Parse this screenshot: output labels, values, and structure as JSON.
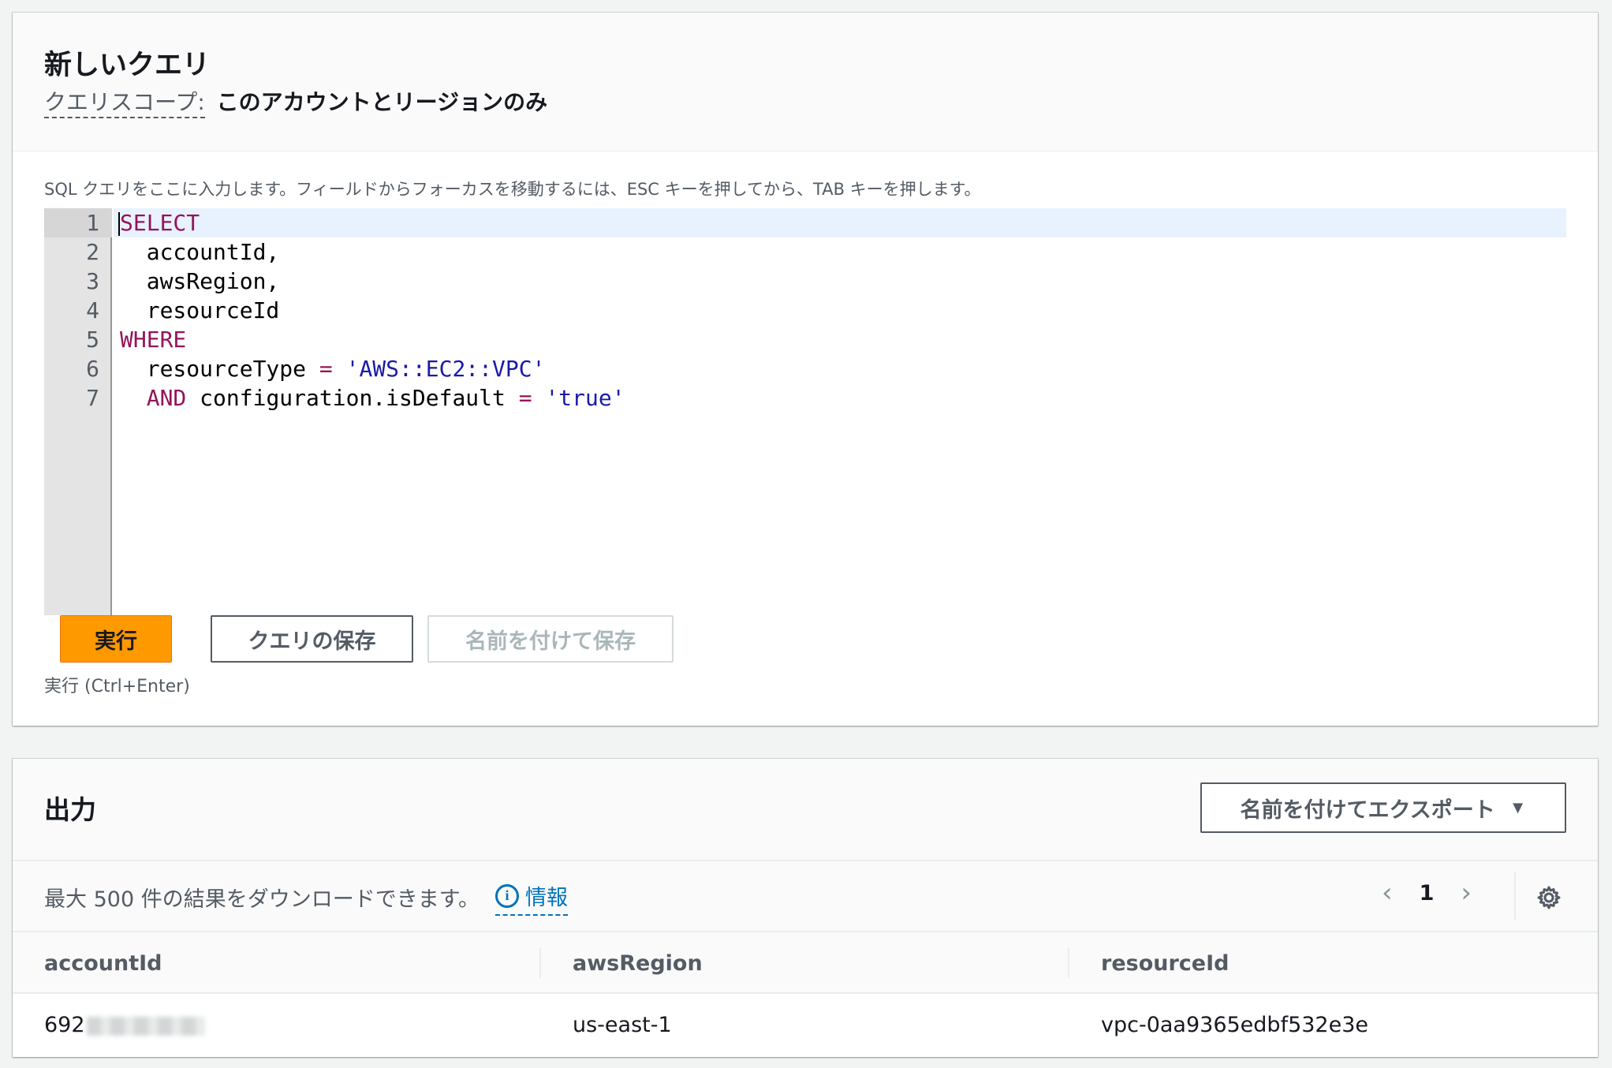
{
  "query": {
    "title": "新しいクエリ",
    "scope_label": "クエリスコープ:",
    "scope_value": "このアカウントとリージョンのみ",
    "editor_hint": "SQL クエリをここに入力します。フィールドからフォーカスを移動するには、ESC キーを押してから、TAB キーを押します。",
    "line_numbers": [
      "1",
      "2",
      "3",
      "4",
      "5",
      "6",
      "7"
    ],
    "code": {
      "l1": "SELECT",
      "l2": "  accountId,",
      "l3": "  awsRegion,",
      "l4": "  resourceId",
      "l5": "WHERE",
      "l6_field": "  resourceType ",
      "l6_op": "=",
      "l6_value": "'AWS::EC2::VPC'",
      "l7_kw": "  AND",
      "l7_field": " configuration.isDefault ",
      "l7_op": "=",
      "l7_value": "'true'"
    },
    "run_label": "実行",
    "save_label": "クエリの保存",
    "save_as_label": "名前を付けて保存",
    "run_hint": "実行 (Ctrl+Enter)"
  },
  "output": {
    "title": "出力",
    "export_label": "名前を付けてエクスポート",
    "export_caret": "▼",
    "download_text": "最大 500 件の結果をダウンロードできます。",
    "info_icon_glyph": "i",
    "info_label": "情報",
    "prev_arrow": "‹",
    "current_page": "1",
    "next_arrow": "›",
    "columns": [
      "accountId",
      "awsRegion",
      "resourceId"
    ],
    "rows": [
      {
        "accountId_visible": "692",
        "awsRegion": "us-east-1",
        "resourceId": "vpc-0aa9365edbf532e3e"
      }
    ]
  },
  "icons": {
    "info": "info-icon",
    "settings": "gear-icon",
    "prev": "chevron-left-icon",
    "next": "chevron-right-icon",
    "dropdown": "caret-down-icon"
  },
  "colors": {
    "accent": "#ff9900",
    "link": "#0073bb",
    "keyword": "#93145a",
    "string": "#1a1aa6"
  }
}
